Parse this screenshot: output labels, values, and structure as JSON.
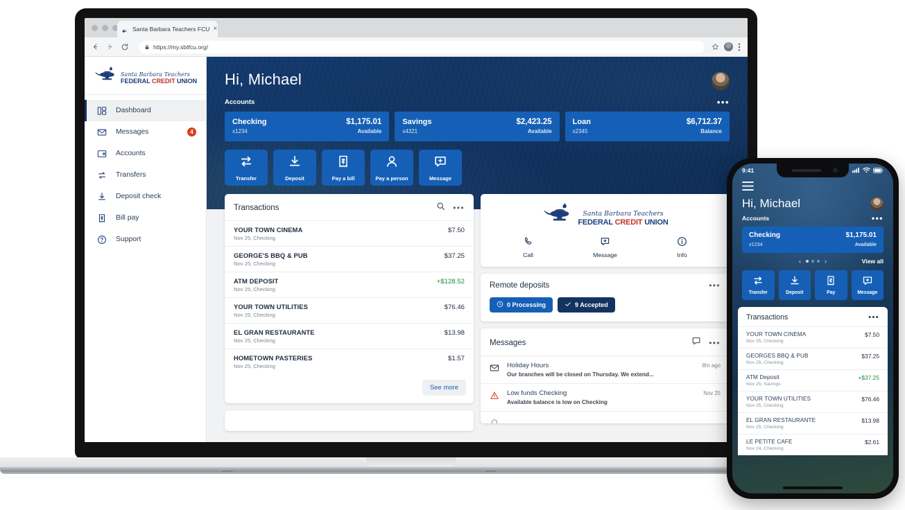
{
  "browser": {
    "tab_title": "Santa Barbara Teachers FCU",
    "tab_close": "×",
    "url": "https://my.sbtfcu.org/",
    "back_icon": "back-arrow-icon",
    "forward_icon": "forward-arrow-icon",
    "reload_icon": "reload-icon",
    "lock_icon": "lock-icon",
    "bookmark_icon": "star-icon",
    "menu_icon": "kebab-menu-icon"
  },
  "brand": {
    "line1": "Santa Barbara Teachers",
    "line2_blue": "FEDERAL",
    "line2_red": "CREDIT",
    "line2_blue2": "UNION",
    "lamp_icon": "lamp-logo-icon",
    "accent_blue": "#1d3f7a",
    "accent_red": "#c2302b"
  },
  "sidebar": {
    "items": [
      {
        "label": "Dashboard",
        "icon": "dashboard-icon",
        "active": true
      },
      {
        "label": "Messages",
        "icon": "envelope-icon",
        "badge": "4"
      },
      {
        "label": "Accounts",
        "icon": "wallet-icon"
      },
      {
        "label": "Transfers",
        "icon": "transfer-arrows-icon"
      },
      {
        "label": "Deposit check",
        "icon": "download-check-icon"
      },
      {
        "label": "Bill pay",
        "icon": "bill-icon"
      },
      {
        "label": "Support",
        "icon": "question-circle-icon"
      }
    ]
  },
  "hero": {
    "greeting": "Hi, Michael",
    "accounts_label": "Accounts",
    "overflow": "•••",
    "avatar": "user-avatar"
  },
  "accounts": [
    {
      "name": "Checking",
      "number": "x1234",
      "amount": "$1,175.01",
      "type": "Available"
    },
    {
      "name": "Savings",
      "number": "x4321",
      "amount": "$2,423.25",
      "type": "Available"
    },
    {
      "name": "Loan",
      "number": "x2345",
      "amount": "$6,712.37",
      "type": "Balance"
    }
  ],
  "quick_actions": [
    {
      "label": "Transfer",
      "icon": "transfer-arrows-icon"
    },
    {
      "label": "Deposit",
      "icon": "download-check-icon"
    },
    {
      "label": "Pay a bill",
      "icon": "bill-icon"
    },
    {
      "label": "Pay a person",
      "icon": "person-icon"
    },
    {
      "label": "Message",
      "icon": "message-plus-icon"
    }
  ],
  "transactions_panel": {
    "title": "Transactions",
    "search_icon": "search-icon",
    "overflow": "•••",
    "see_more": "See more",
    "rows": [
      {
        "name": "YOUR TOWN CINEMA",
        "meta": "Nov 25, Checking",
        "amount": "$7.50",
        "positive": false
      },
      {
        "name": "GEORGE'S BBQ & PUB",
        "meta": "Nov 25, Checking",
        "amount": "$37.25",
        "positive": false
      },
      {
        "name": "ATM DEPOSIT",
        "meta": "Nov 25, Checking",
        "amount": "+$128.52",
        "positive": true
      },
      {
        "name": "YOUR TOWN UTILITIES",
        "meta": "Nov 25, Checking",
        "amount": "$76.46",
        "positive": false
      },
      {
        "name": "EL GRAN RESTAURANTE",
        "meta": "Nov 25, Checking",
        "amount": "$13.98",
        "positive": false
      },
      {
        "name": "HOMETOWN PASTERIES",
        "meta": "Nov 25, Checking",
        "amount": "$1.57",
        "positive": false
      }
    ]
  },
  "contact_card": {
    "actions": [
      {
        "label": "Call",
        "icon": "phone-icon"
      },
      {
        "label": "Message",
        "icon": "message-plus-icon"
      },
      {
        "label": "Info",
        "icon": "info-circle-icon"
      }
    ]
  },
  "remote_deposits": {
    "title": "Remote deposits",
    "overflow": "•••",
    "chips": [
      {
        "label": "0 Processing",
        "icon": "clock-icon",
        "style": "a"
      },
      {
        "label": "9 Accepted",
        "icon": "check-icon",
        "style": "b"
      }
    ]
  },
  "messages_panel": {
    "title": "Messages",
    "compose_icon": "message-icon",
    "overflow": "•••",
    "rows": [
      {
        "icon": "envelope-icon",
        "title": "Holiday Hours",
        "time": "8hr ago",
        "sub": "Our branches will be closed on Thursday. We extend..."
      },
      {
        "icon": "warning-triangle-icon",
        "title": "Low funds Checking",
        "time": "Nov 25",
        "sub": "Available balance is low on Checking"
      }
    ]
  },
  "phone": {
    "status": {
      "time": "9:41",
      "signal_icon": "cellular-icon",
      "wifi_icon": "wifi-icon",
      "battery_icon": "battery-icon"
    },
    "menu_icon": "hamburger-menu-icon",
    "greeting": "Hi, Michael",
    "avatar": "user-avatar",
    "accounts_label": "Accounts",
    "overflow": "•••",
    "account": {
      "name": "Checking",
      "number": "x1234",
      "amount": "$1,175.01",
      "type": "Available"
    },
    "pager": {
      "prev": "‹",
      "next": "›",
      "view_all": "View all"
    },
    "quick_actions": [
      {
        "label": "Transfer",
        "icon": "transfer-arrows-icon"
      },
      {
        "label": "Deposit",
        "icon": "download-check-icon"
      },
      {
        "label": "Pay",
        "icon": "bill-icon"
      },
      {
        "label": "Message",
        "icon": "message-plus-icon"
      }
    ],
    "transactions_title": "Transactions",
    "transactions": [
      {
        "name": "YOUR TOWN CINEMA",
        "meta": "Nov 25, Checking",
        "amount": "$7.50",
        "positive": false
      },
      {
        "name": "GEORGES BBQ & PUB",
        "meta": "Nov 25, Checking",
        "amount": "$37.25",
        "positive": false
      },
      {
        "name": "ATM Deposit",
        "meta": "Nov 25, Savings",
        "amount": "+$37.25",
        "positive": true
      },
      {
        "name": "YOUR TOWN UTILITIES",
        "meta": "Nov 25, Checking",
        "amount": "$76.46",
        "positive": false
      },
      {
        "name": "EL GRAN RESTAURANTE",
        "meta": "Nov 25, Checking",
        "amount": "$13.98",
        "positive": false
      },
      {
        "name": "LE PETITE CAFE",
        "meta": "Nov 24, Checking",
        "amount": "$2.61",
        "positive": false
      }
    ]
  }
}
